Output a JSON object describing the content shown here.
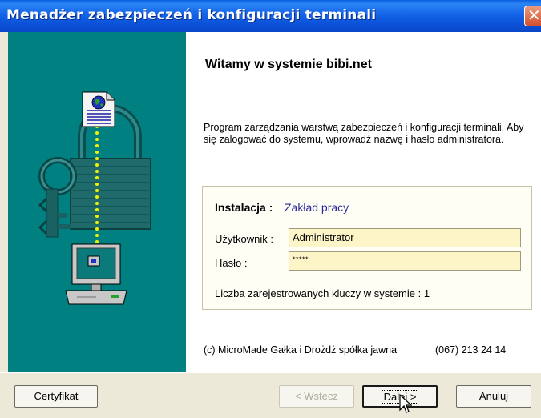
{
  "window": {
    "title": "Menadżer zabezpieczeń i konfiguracji terminali"
  },
  "content": {
    "heading": "Witamy w systemie bibi.net",
    "description": "Program zarządzania warstwą zabezpieczeń i konfiguracji terminali. Aby się zalogować do systemu, wprowadź nazwę i hasło administratora.",
    "installation_label": "Instalacja :",
    "installation_value": "Zakład pracy",
    "user_label": "Użytkownik :",
    "user_value": "Administrator",
    "password_label": "Hasło :",
    "password_value": "*****",
    "keys_text": "Liczba zarejestrowanych kluczy w systemie : 1",
    "copyright": "(c) MicroMade Gałka i Drożdż spółka jawna",
    "phone": "(067) 213 24 14"
  },
  "buttons": {
    "certificate": "Certyfikat",
    "back": "< Wstecz",
    "next": "Dalej >",
    "cancel": "Anuluj"
  },
  "colors": {
    "titlebar": "#0b52d8",
    "sidebar": "#008080",
    "field_bg": "#fdf4c8",
    "link": "#2a2a9a"
  },
  "icons": [
    "close-icon",
    "document-globe-icon",
    "padlock-keys-icon",
    "computer-icon",
    "mouse-pointer-icon"
  ]
}
